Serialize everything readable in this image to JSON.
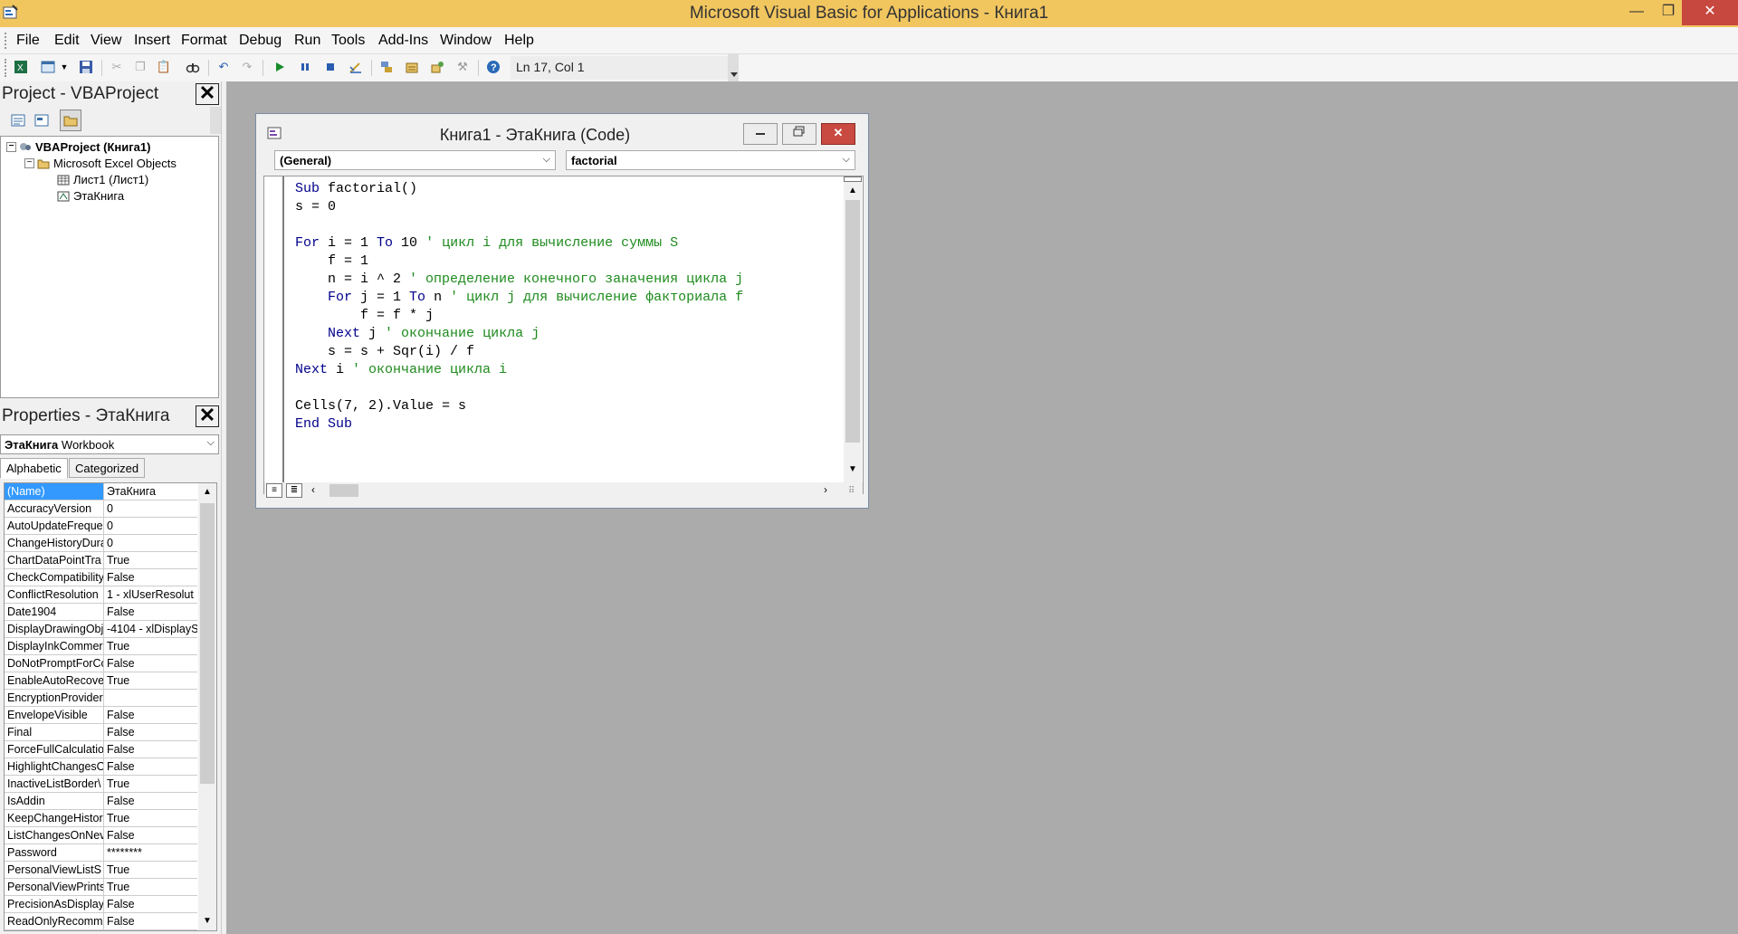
{
  "window": {
    "title": "Microsoft Visual Basic for Applications - Книга1",
    "min_glyph": "—",
    "max_glyph": "❐",
    "close_glyph": "✕"
  },
  "menu": [
    "File",
    "Edit",
    "View",
    "Insert",
    "Format",
    "Debug",
    "Run",
    "Tools",
    "Add-Ins",
    "Window",
    "Help"
  ],
  "toolbar": {
    "icons": [
      "excel-view-icon",
      "insert-userform-icon",
      "dropdown-arrow-icon",
      "save-icon",
      "cut-icon",
      "copy-icon",
      "paste-icon",
      "find-icon",
      "undo-icon",
      "redo-icon",
      "run-icon",
      "break-icon",
      "reset-icon",
      "design-mode-icon",
      "project-explorer-icon",
      "properties-window-icon",
      "object-browser-icon",
      "toolbox-icon",
      "help-icon"
    ],
    "position": "Ln 17, Col 1"
  },
  "project_pane": {
    "title": "Project - VBAProject",
    "close_glyph": "✕",
    "tree": [
      {
        "label": "VBAProject (Книга1)",
        "bold": true,
        "icon": "vba-project-icon",
        "expander": "−"
      },
      {
        "label": "Microsoft Excel Objects",
        "bold": false,
        "icon": "folder-icon",
        "expander": "−"
      },
      {
        "label": "Лист1 (Лист1)",
        "bold": false,
        "icon": "worksheet-icon",
        "expander": ""
      },
      {
        "label": "ЭтаКнига",
        "bold": false,
        "icon": "workbook-icon",
        "expander": ""
      }
    ]
  },
  "properties_pane": {
    "title": "Properties - ЭтаКнига",
    "close_glyph": "✕",
    "object_name": "ЭтаКнига",
    "object_type": "Workbook",
    "tabs": [
      "Alphabetic",
      "Categorized"
    ],
    "rows": [
      {
        "name": "(Name)",
        "value": "ЭтаКнига"
      },
      {
        "name": "AccuracyVersion",
        "value": "0"
      },
      {
        "name": "AutoUpdateFreque",
        "value": "0"
      },
      {
        "name": "ChangeHistoryDura",
        "value": "0"
      },
      {
        "name": "ChartDataPointTra",
        "value": "True"
      },
      {
        "name": "CheckCompatibility",
        "value": "False"
      },
      {
        "name": "ConflictResolution",
        "value": "1 - xlUserResolut"
      },
      {
        "name": "Date1904",
        "value": "False"
      },
      {
        "name": "DisplayDrawingObj",
        "value": "-4104 - xlDisplayS"
      },
      {
        "name": "DisplayInkCommer",
        "value": "True"
      },
      {
        "name": "DoNotPromptForCc",
        "value": "False"
      },
      {
        "name": "EnableAutoRecove",
        "value": "True"
      },
      {
        "name": "EncryptionProvider",
        "value": ""
      },
      {
        "name": "EnvelopeVisible",
        "value": "False"
      },
      {
        "name": "Final",
        "value": "False"
      },
      {
        "name": "ForceFullCalculatio",
        "value": "False"
      },
      {
        "name": "HighlightChangesO",
        "value": "False"
      },
      {
        "name": "InactiveListBorder\\",
        "value": "True"
      },
      {
        "name": "IsAddin",
        "value": "False"
      },
      {
        "name": "KeepChangeHistor",
        "value": "True"
      },
      {
        "name": "ListChangesOnNev",
        "value": "False"
      },
      {
        "name": "Password",
        "value": "********"
      },
      {
        "name": "PersonalViewListS",
        "value": "True"
      },
      {
        "name": "PersonalViewPrints",
        "value": "True"
      },
      {
        "name": "PrecisionAsDisplay",
        "value": "False"
      },
      {
        "name": "ReadOnlyRecomm",
        "value": "False"
      }
    ]
  },
  "code_window": {
    "title": "Книга1 - ЭтаКнига (Code)",
    "object_combo": "(General)",
    "procedure_combo": "factorial",
    "lines": [
      [
        {
          "t": "Sub",
          "c": "kw"
        },
        {
          "t": " factorial()",
          "c": ""
        }
      ],
      [
        {
          "t": "s = 0",
          "c": ""
        }
      ],
      [],
      [
        {
          "t": "For",
          "c": "kw"
        },
        {
          "t": " i = 1 ",
          "c": ""
        },
        {
          "t": "To",
          "c": "kw"
        },
        {
          "t": " 10 ",
          "c": ""
        },
        {
          "t": "' цикл i для вычисление суммы S",
          "c": "cm"
        }
      ],
      [
        {
          "t": "    f = 1",
          "c": ""
        }
      ],
      [
        {
          "t": "    n = i ^ 2 ",
          "c": ""
        },
        {
          "t": "' определение конечного заначения цикла j",
          "c": "cm"
        }
      ],
      [
        {
          "t": "    ",
          "c": ""
        },
        {
          "t": "For",
          "c": "kw"
        },
        {
          "t": " j = 1 ",
          "c": ""
        },
        {
          "t": "To",
          "c": "kw"
        },
        {
          "t": " n ",
          "c": ""
        },
        {
          "t": "' цикл j для вычисление факториала f",
          "c": "cm"
        }
      ],
      [
        {
          "t": "        f = f * j",
          "c": ""
        }
      ],
      [
        {
          "t": "    ",
          "c": ""
        },
        {
          "t": "Next",
          "c": "kw"
        },
        {
          "t": " j ",
          "c": ""
        },
        {
          "t": "' окончание цикла j",
          "c": "cm"
        }
      ],
      [
        {
          "t": "    s = s + Sqr(i) / f",
          "c": ""
        }
      ],
      [
        {
          "t": "Next",
          "c": "kw"
        },
        {
          "t": " i ",
          "c": ""
        },
        {
          "t": "' окончание цикла i",
          "c": "cm"
        }
      ],
      [],
      [
        {
          "t": "Cells(7, 2).Value = s",
          "c": ""
        }
      ],
      [
        {
          "t": "End Sub",
          "c": "kw"
        }
      ]
    ]
  },
  "colors": {
    "titlebar": "#f2c65f",
    "keyword": "#00008b",
    "comment": "#1e8b1e",
    "selection": "#3399ff",
    "workspace": "#ababab"
  }
}
